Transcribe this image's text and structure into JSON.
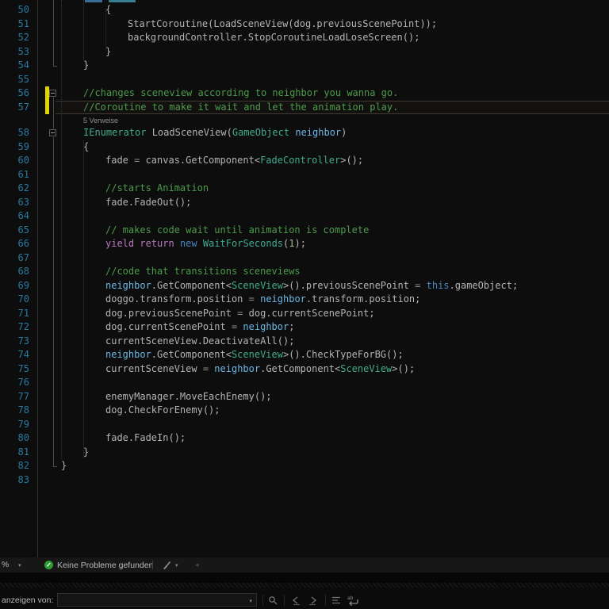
{
  "editor": {
    "codelens_label": "5 Verweise",
    "lines": [
      {
        "no": 50,
        "indent": 2,
        "tokens": [
          {
            "c": "pl",
            "t": "{"
          }
        ]
      },
      {
        "no": 51,
        "indent": 3,
        "tokens": [
          {
            "c": "pl",
            "t": "StartCoroutine(LoadSceneView(dog.previousScenePoint));"
          }
        ]
      },
      {
        "no": 52,
        "indent": 3,
        "tokens": [
          {
            "c": "pl",
            "t": "backgroundController.StopCoroutineLoadLoseScreen();"
          }
        ]
      },
      {
        "no": 53,
        "indent": 2,
        "tokens": [
          {
            "c": "pl",
            "t": "}"
          }
        ]
      },
      {
        "no": 54,
        "indent": 1,
        "tokens": [
          {
            "c": "pl",
            "t": "}"
          }
        ]
      },
      {
        "no": 55,
        "indent": 0,
        "tokens": []
      },
      {
        "no": 56,
        "indent": 1,
        "changed": true,
        "fold": true,
        "tokens": [
          {
            "c": "cm",
            "t": "//changes sceneview according to neighbor you wanna go."
          }
        ]
      },
      {
        "no": 57,
        "indent": 1,
        "changed": true,
        "current": true,
        "tokens": [
          {
            "c": "cm",
            "t": "//Coroutine to make it wait and let the animation play."
          }
        ]
      },
      {
        "no": 58,
        "indent": 1,
        "codelens": "5 Verweise",
        "fold": true,
        "tokens": [
          {
            "c": "ty",
            "t": "IEnumerator"
          },
          {
            "c": "pl",
            "t": " LoadSceneView("
          },
          {
            "c": "ty",
            "t": "GameObject"
          },
          {
            "c": "pl",
            "t": " "
          },
          {
            "c": "pa",
            "t": "neighbor"
          },
          {
            "c": "pl",
            "t": ")"
          }
        ]
      },
      {
        "no": 59,
        "indent": 1,
        "tokens": [
          {
            "c": "pl",
            "t": "{"
          }
        ]
      },
      {
        "no": 60,
        "indent": 2,
        "tokens": [
          {
            "c": "pl",
            "t": "fade "
          },
          {
            "c": "op",
            "t": "="
          },
          {
            "c": "pl",
            "t": " canvas.GetComponent<"
          },
          {
            "c": "ty",
            "t": "FadeController"
          },
          {
            "c": "pl",
            "t": ">();"
          }
        ]
      },
      {
        "no": 61,
        "indent": 0,
        "tokens": []
      },
      {
        "no": 62,
        "indent": 2,
        "tokens": [
          {
            "c": "cm",
            "t": "//starts Animation"
          }
        ]
      },
      {
        "no": 63,
        "indent": 2,
        "tokens": [
          {
            "c": "pl",
            "t": "fade.FadeOut();"
          }
        ]
      },
      {
        "no": 64,
        "indent": 0,
        "tokens": []
      },
      {
        "no": 65,
        "indent": 2,
        "tokens": [
          {
            "c": "cm",
            "t": "// makes code wait until animation is complete"
          }
        ]
      },
      {
        "no": 66,
        "indent": 2,
        "tokens": [
          {
            "c": "ct",
            "t": "yield"
          },
          {
            "c": "pl",
            "t": " "
          },
          {
            "c": "ct",
            "t": "return"
          },
          {
            "c": "pl",
            "t": " "
          },
          {
            "c": "kw",
            "t": "new"
          },
          {
            "c": "pl",
            "t": " "
          },
          {
            "c": "ty",
            "t": "WaitForSeconds"
          },
          {
            "c": "pl",
            "t": "("
          },
          {
            "c": "nu",
            "t": "1"
          },
          {
            "c": "pl",
            "t": ");"
          }
        ]
      },
      {
        "no": 67,
        "indent": 0,
        "tokens": []
      },
      {
        "no": 68,
        "indent": 2,
        "tokens": [
          {
            "c": "cm",
            "t": "//code that transitions sceneviews"
          }
        ]
      },
      {
        "no": 69,
        "indent": 2,
        "tokens": [
          {
            "c": "pa",
            "t": "neighbor"
          },
          {
            "c": "pl",
            "t": ".GetComponent<"
          },
          {
            "c": "ty",
            "t": "SceneView"
          },
          {
            "c": "pl",
            "t": ">().previousScenePoint "
          },
          {
            "c": "op",
            "t": "="
          },
          {
            "c": "pl",
            "t": " "
          },
          {
            "c": "kw",
            "t": "this"
          },
          {
            "c": "pl",
            "t": ".gameObject;"
          }
        ]
      },
      {
        "no": 70,
        "indent": 2,
        "tokens": [
          {
            "c": "pl",
            "t": "doggo.transform.position "
          },
          {
            "c": "op",
            "t": "="
          },
          {
            "c": "pl",
            "t": " "
          },
          {
            "c": "pa",
            "t": "neighbor"
          },
          {
            "c": "pl",
            "t": ".transform.position;"
          }
        ]
      },
      {
        "no": 71,
        "indent": 2,
        "tokens": [
          {
            "c": "pl",
            "t": "dog.previousScenePoint "
          },
          {
            "c": "op",
            "t": "="
          },
          {
            "c": "pl",
            "t": " dog.currentScenePoint;"
          }
        ]
      },
      {
        "no": 72,
        "indent": 2,
        "tokens": [
          {
            "c": "pl",
            "t": "dog.currentScenePoint "
          },
          {
            "c": "op",
            "t": "="
          },
          {
            "c": "pl",
            "t": " "
          },
          {
            "c": "pa",
            "t": "neighbor"
          },
          {
            "c": "pl",
            "t": ";"
          }
        ]
      },
      {
        "no": 73,
        "indent": 2,
        "tokens": [
          {
            "c": "pl",
            "t": "currentSceneView.DeactivateAll();"
          }
        ]
      },
      {
        "no": 74,
        "indent": 2,
        "tokens": [
          {
            "c": "pa",
            "t": "neighbor"
          },
          {
            "c": "pl",
            "t": ".GetComponent<"
          },
          {
            "c": "ty",
            "t": "SceneView"
          },
          {
            "c": "pl",
            "t": ">().CheckTypeForBG();"
          }
        ]
      },
      {
        "no": 75,
        "indent": 2,
        "tokens": [
          {
            "c": "pl",
            "t": "currentSceneView "
          },
          {
            "c": "op",
            "t": "="
          },
          {
            "c": "pl",
            "t": " "
          },
          {
            "c": "pa",
            "t": "neighbor"
          },
          {
            "c": "pl",
            "t": ".GetComponent<"
          },
          {
            "c": "ty",
            "t": "SceneView"
          },
          {
            "c": "pl",
            "t": ">();"
          }
        ]
      },
      {
        "no": 76,
        "indent": 0,
        "tokens": []
      },
      {
        "no": 77,
        "indent": 2,
        "tokens": [
          {
            "c": "pl",
            "t": "enemyManager.MoveEachEnemy();"
          }
        ]
      },
      {
        "no": 78,
        "indent": 2,
        "tokens": [
          {
            "c": "pl",
            "t": "dog.CheckForEnemy();"
          }
        ]
      },
      {
        "no": 79,
        "indent": 0,
        "tokens": []
      },
      {
        "no": 80,
        "indent": 2,
        "tokens": [
          {
            "c": "pl",
            "t": "fade.FadeIn();"
          }
        ]
      },
      {
        "no": 81,
        "indent": 1,
        "tokens": [
          {
            "c": "pl",
            "t": "}"
          }
        ]
      },
      {
        "no": 82,
        "indent": 0,
        "tokens": [
          {
            "c": "pl",
            "t": "}"
          }
        ]
      },
      {
        "no": 83,
        "indent": 0,
        "tokens": []
      }
    ]
  },
  "statusbar": {
    "zoom_suffix": "%",
    "health_text": "Keine Probleme gefunden",
    "check_icon": "checkmark-circle",
    "check_color": "#2f9b33"
  },
  "output_panel": {
    "show_from_label": "anzeigen von:",
    "combo_value": "",
    "icons": [
      "find-message-icon",
      "previous-message-icon",
      "next-message-icon",
      "clear-all-icon",
      "word-wrap-icon"
    ]
  },
  "colors": {
    "comment": "#4c9b4b",
    "keyword": "#4a86c4",
    "control_keyword": "#b877be",
    "type": "#40ab8e",
    "parameter": "#6cb6e4",
    "line_number": "#2b7aa0",
    "change_bar": "#e3d400"
  }
}
